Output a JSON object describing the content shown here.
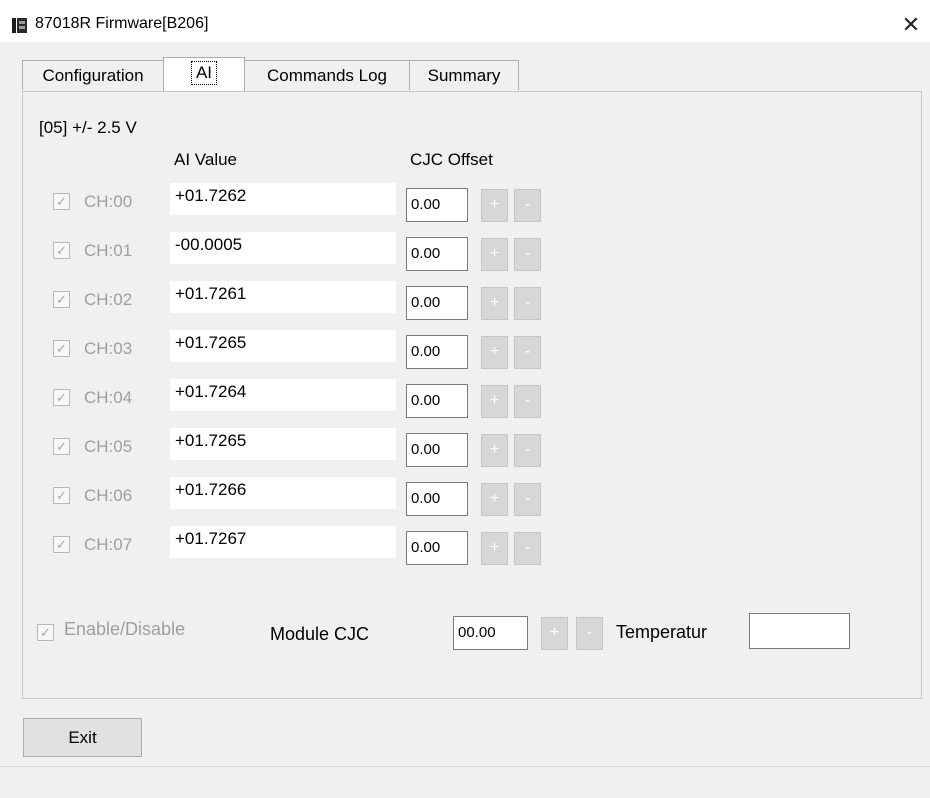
{
  "window": {
    "title": "87018R Firmware[B206]",
    "close_glyph": "✕"
  },
  "tabs": [
    {
      "label": "Configuration"
    },
    {
      "label": "AI"
    },
    {
      "label": "Commands Log"
    },
    {
      "label": "Summary"
    }
  ],
  "ai_panel": {
    "range_label": "[05] +/- 2.5 V",
    "col_ai_value": "AI Value",
    "col_cjc_offset": "CJC Offset",
    "channels": [
      {
        "label": "CH:00",
        "value": "+01.7262",
        "cjc": "0.00",
        "checked": true
      },
      {
        "label": "CH:01",
        "value": "-00.0005",
        "cjc": "0.00",
        "checked": true
      },
      {
        "label": "CH:02",
        "value": "+01.7261",
        "cjc": "0.00",
        "checked": true
      },
      {
        "label": "CH:03",
        "value": "+01.7265",
        "cjc": "0.00",
        "checked": true
      },
      {
        "label": "CH:04",
        "value": "+01.7264",
        "cjc": "0.00",
        "checked": true
      },
      {
        "label": "CH:05",
        "value": "+01.7265",
        "cjc": "0.00",
        "checked": true
      },
      {
        "label": "CH:06",
        "value": "+01.7266",
        "cjc": "0.00",
        "checked": true
      },
      {
        "label": "CH:07",
        "value": "+01.7267",
        "cjc": "0.00",
        "checked": true
      }
    ],
    "plus_label": "+",
    "minus_label": "-",
    "enable_label": "Enable/Disable",
    "module_cjc_label": "Module CJC",
    "module_cjc_value": "00.00",
    "temperature_label": "Temperatur",
    "temperature_value": ""
  },
  "footer": {
    "exit_label": "Exit"
  },
  "icons": {
    "checkmark": "✓"
  }
}
